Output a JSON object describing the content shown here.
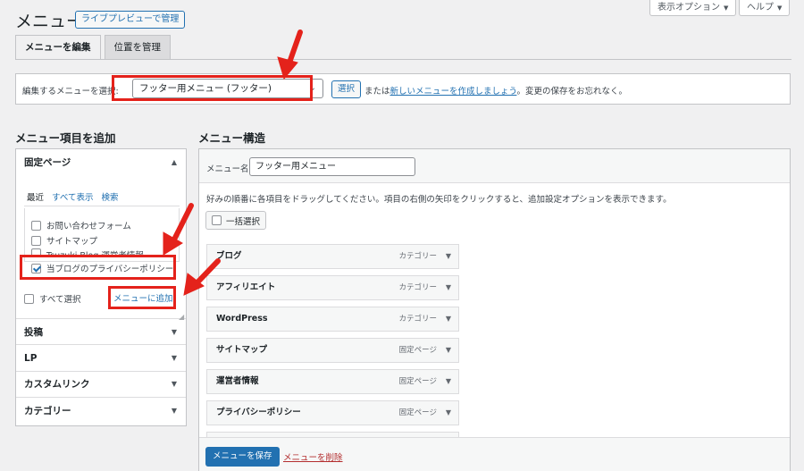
{
  "header": {
    "title": "メニュー",
    "live_preview_label": "ライブプレビューで管理",
    "screen_options_label": "表示オプション",
    "help_label": "ヘルプ"
  },
  "tabs": [
    {
      "label": "メニューを編集",
      "active": true
    },
    {
      "label": "位置を管理",
      "active": false
    }
  ],
  "select_bar": {
    "label": "編集するメニューを選択:",
    "selected_menu": "フッター用メニュー (フッター)",
    "select_button": "選択",
    "text_before": "または",
    "create_link": "新しいメニューを作成しましょう",
    "text_after": "。変更の保存をお忘れなく。"
  },
  "left": {
    "heading": "メニュー項目を追加",
    "pages_section": "固定ページ",
    "inner_tabs": [
      "最近",
      "すべて表示",
      "検索"
    ],
    "page_items": [
      {
        "label": "お問い合わせフォーム",
        "checked": false
      },
      {
        "label": "サイトマップ",
        "checked": false
      },
      {
        "label": "Tsuzuki Blog 運営者情報",
        "checked": false
      },
      {
        "label": "当ブログのプライバシーポリシー",
        "checked": true
      }
    ],
    "select_all": "すべて選択",
    "add_to_menu": "メニューに追加",
    "sections": [
      "投稿",
      "LP",
      "カスタムリンク",
      "カテゴリー"
    ]
  },
  "right": {
    "heading": "メニュー構造",
    "name_label": "メニュー名",
    "menu_name": "フッター用メニュー",
    "instructions": "好みの順番に各項目をドラッグしてください。項目の右側の矢印をクリックすると、追加設定オプションを表示できます。",
    "bulk_select": "一括選択",
    "items": [
      {
        "title": "ブログ",
        "type": "カテゴリー"
      },
      {
        "title": "アフィリエイト",
        "type": "カテゴリー"
      },
      {
        "title": "WordPress",
        "type": "カテゴリー"
      },
      {
        "title": "サイトマップ",
        "type": "固定ページ"
      },
      {
        "title": "運営者情報",
        "type": "固定ページ"
      },
      {
        "title": "プライバシーポリシー",
        "type": "固定ページ"
      }
    ],
    "save_button": "メニューを保存",
    "delete_link": "メニューを削除"
  },
  "colors": {
    "accent": "#2271b1",
    "annotation": "#e4221b",
    "danger": "#b32d2e"
  }
}
